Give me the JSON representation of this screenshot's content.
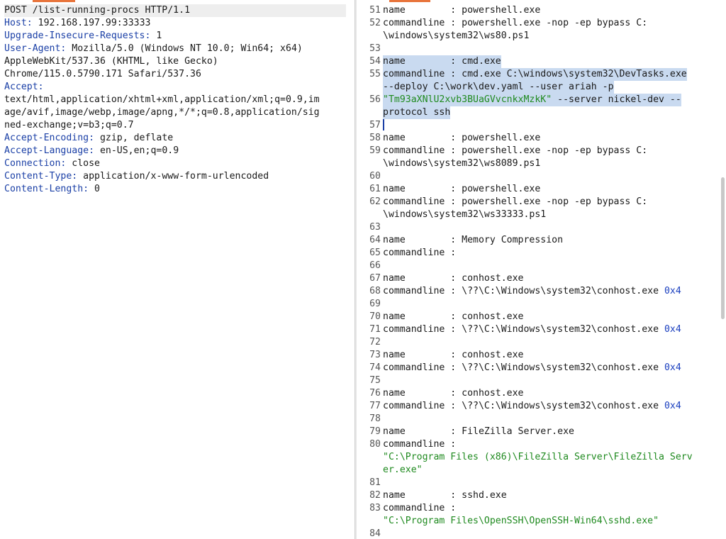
{
  "request": {
    "request_line": "POST /list-running-procs HTTP/1.1",
    "headers": [
      {
        "name": "Host",
        "value": "192.168.197.99:33333"
      },
      {
        "name": "Upgrade-Insecure-Requests",
        "value": "1"
      },
      {
        "name": "User-Agent",
        "value": "Mozilla/5.0 (Windows NT 10.0; Win64; x64)"
      },
      {
        "name": "",
        "value": "AppleWebKit/537.36 (KHTML, like Gecko)"
      },
      {
        "name": "",
        "value": "Chrome/115.0.5790.171 Safari/537.36"
      },
      {
        "name": "Accept",
        "value": ""
      },
      {
        "name": "",
        "value": "text/html,application/xhtml+xml,application/xml;q=0.9,im"
      },
      {
        "name": "",
        "value": "age/avif,image/webp,image/apng,*/*;q=0.8,application/sig"
      },
      {
        "name": "",
        "value": "ned-exchange;v=b3;q=0.7"
      },
      {
        "name": "Accept-Encoding",
        "value": "gzip, deflate"
      },
      {
        "name": "Accept-Language",
        "value": "en-US,en;q=0.9"
      },
      {
        "name": "Connection",
        "value": "close"
      },
      {
        "name": "Content-Type",
        "value": "application/x-www-form-urlencoded"
      },
      {
        "name": "Content-Length",
        "value": "0"
      }
    ]
  },
  "response": {
    "lines": [
      {
        "num": "51",
        "segs": [
          {
            "t": "name        : powershell.exe"
          }
        ]
      },
      {
        "num": "52",
        "segs": [
          {
            "t": "commandline : powershell.exe -nop -ep bypass C:"
          }
        ]
      },
      {
        "num": "",
        "segs": [
          {
            "t": "\\windows\\system32\\ws80.ps1"
          }
        ]
      },
      {
        "num": "53",
        "segs": []
      },
      {
        "num": "54",
        "sel": true,
        "segs": [
          {
            "t": "name        : cmd.exe"
          }
        ]
      },
      {
        "num": "55",
        "sel": true,
        "segs": [
          {
            "t": "commandline : cmd.exe C:\\windows\\system32\\DevTasks.exe"
          }
        ]
      },
      {
        "num": "",
        "sel": true,
        "segs": [
          {
            "t": "--deploy C:\\work\\dev.yaml --user ariah -p"
          }
        ]
      },
      {
        "num": "56",
        "sel": true,
        "segs": [
          {
            "t": "\"Tm93aXNlU2xvb3BUaGVvcnkxMzkK\"",
            "c": "str"
          },
          {
            "t": " --server nickel-dev --"
          }
        ]
      },
      {
        "num": "",
        "sel": true,
        "segs": [
          {
            "t": "protocol ssh"
          }
        ]
      },
      {
        "num": "57",
        "segs": []
      },
      {
        "num": "58",
        "segs": [
          {
            "t": "name        : powershell.exe"
          }
        ]
      },
      {
        "num": "59",
        "segs": [
          {
            "t": "commandline : powershell.exe -nop -ep bypass C:"
          }
        ]
      },
      {
        "num": "",
        "segs": [
          {
            "t": "\\windows\\system32\\ws8089.ps1"
          }
        ]
      },
      {
        "num": "60",
        "segs": []
      },
      {
        "num": "61",
        "segs": [
          {
            "t": "name        : powershell.exe"
          }
        ]
      },
      {
        "num": "62",
        "segs": [
          {
            "t": "commandline : powershell.exe -nop -ep bypass C:"
          }
        ]
      },
      {
        "num": "",
        "segs": [
          {
            "t": "\\windows\\system32\\ws33333.ps1"
          }
        ]
      },
      {
        "num": "63",
        "segs": []
      },
      {
        "num": "64",
        "segs": [
          {
            "t": "name        : Memory Compression"
          }
        ]
      },
      {
        "num": "65",
        "segs": [
          {
            "t": "commandline :"
          }
        ]
      },
      {
        "num": "66",
        "segs": []
      },
      {
        "num": "67",
        "segs": [
          {
            "t": "name        : conhost.exe"
          }
        ]
      },
      {
        "num": "68",
        "segs": [
          {
            "t": "commandline : \\??\\C:\\Windows\\system32\\conhost.exe "
          },
          {
            "t": "0x4",
            "c": "hex"
          }
        ]
      },
      {
        "num": "69",
        "segs": []
      },
      {
        "num": "70",
        "segs": [
          {
            "t": "name        : conhost.exe"
          }
        ]
      },
      {
        "num": "71",
        "segs": [
          {
            "t": "commandline : \\??\\C:\\Windows\\system32\\conhost.exe "
          },
          {
            "t": "0x4",
            "c": "hex"
          }
        ]
      },
      {
        "num": "72",
        "segs": []
      },
      {
        "num": "73",
        "segs": [
          {
            "t": "name        : conhost.exe"
          }
        ]
      },
      {
        "num": "74",
        "segs": [
          {
            "t": "commandline : \\??\\C:\\Windows\\system32\\conhost.exe "
          },
          {
            "t": "0x4",
            "c": "hex"
          }
        ]
      },
      {
        "num": "75",
        "segs": []
      },
      {
        "num": "76",
        "segs": [
          {
            "t": "name        : conhost.exe"
          }
        ]
      },
      {
        "num": "77",
        "segs": [
          {
            "t": "commandline : \\??\\C:\\Windows\\system32\\conhost.exe "
          },
          {
            "t": "0x4",
            "c": "hex"
          }
        ]
      },
      {
        "num": "78",
        "segs": []
      },
      {
        "num": "79",
        "segs": [
          {
            "t": "name        : FileZilla Server.exe"
          }
        ]
      },
      {
        "num": "80",
        "segs": [
          {
            "t": "commandline :"
          }
        ]
      },
      {
        "num": "",
        "segs": [
          {
            "t": "\"C:\\Program Files (x86)\\FileZilla Server\\FileZilla Serv",
            "c": "str"
          }
        ]
      },
      {
        "num": "",
        "segs": [
          {
            "t": "er.exe\"",
            "c": "str"
          }
        ]
      },
      {
        "num": "81",
        "segs": []
      },
      {
        "num": "82",
        "segs": [
          {
            "t": "name        : sshd.exe"
          }
        ]
      },
      {
        "num": "83",
        "segs": [
          {
            "t": "commandline :"
          }
        ]
      },
      {
        "num": "",
        "segs": [
          {
            "t": "\"C:\\Program Files\\OpenSSH\\OpenSSH-Win64\\sshd.exe\"",
            "c": "str"
          }
        ]
      },
      {
        "num": "84",
        "segs": []
      }
    ]
  }
}
